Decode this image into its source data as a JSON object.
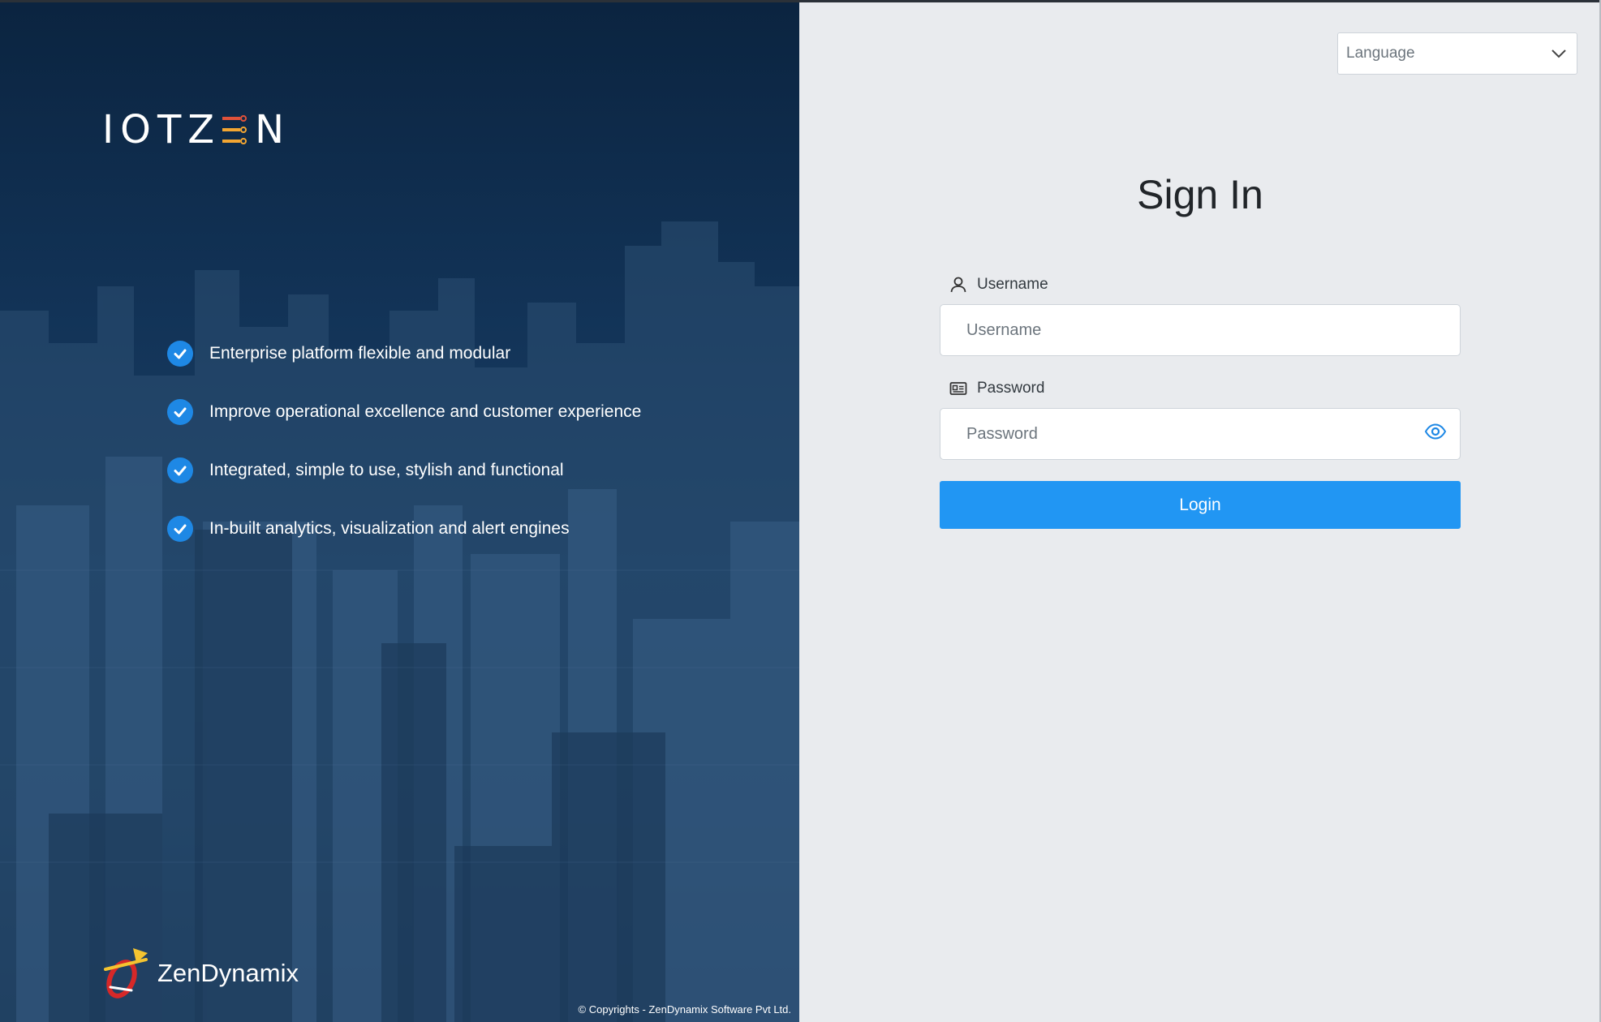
{
  "logo": {
    "text_left": "IOTZ",
    "text_right": "N"
  },
  "features": [
    "Enterprise platform flexible and modular",
    "Improve operational excellence and customer experience",
    "Integrated, simple to use, stylish and functional",
    "In-built analytics, visualization and alert engines"
  ],
  "brand": {
    "name": "ZenDynamix"
  },
  "copyright": "© Copyrights - ZenDynamix Software Pvt Ltd.",
  "language": {
    "placeholder": "Language"
  },
  "signin": {
    "title": "Sign In",
    "username_label": "Username",
    "username_placeholder": "Username",
    "password_label": "Password",
    "password_placeholder": "Password",
    "login_label": "Login"
  },
  "colors": {
    "accent": "#2196f3",
    "check": "#1e88e5",
    "left_panel": "#15365a",
    "right_panel": "#e9ebee"
  },
  "icons": [
    "check-icon",
    "chevron-down-icon",
    "user-icon",
    "id-card-icon",
    "eye-icon",
    "zendynamix-logo-icon"
  ]
}
